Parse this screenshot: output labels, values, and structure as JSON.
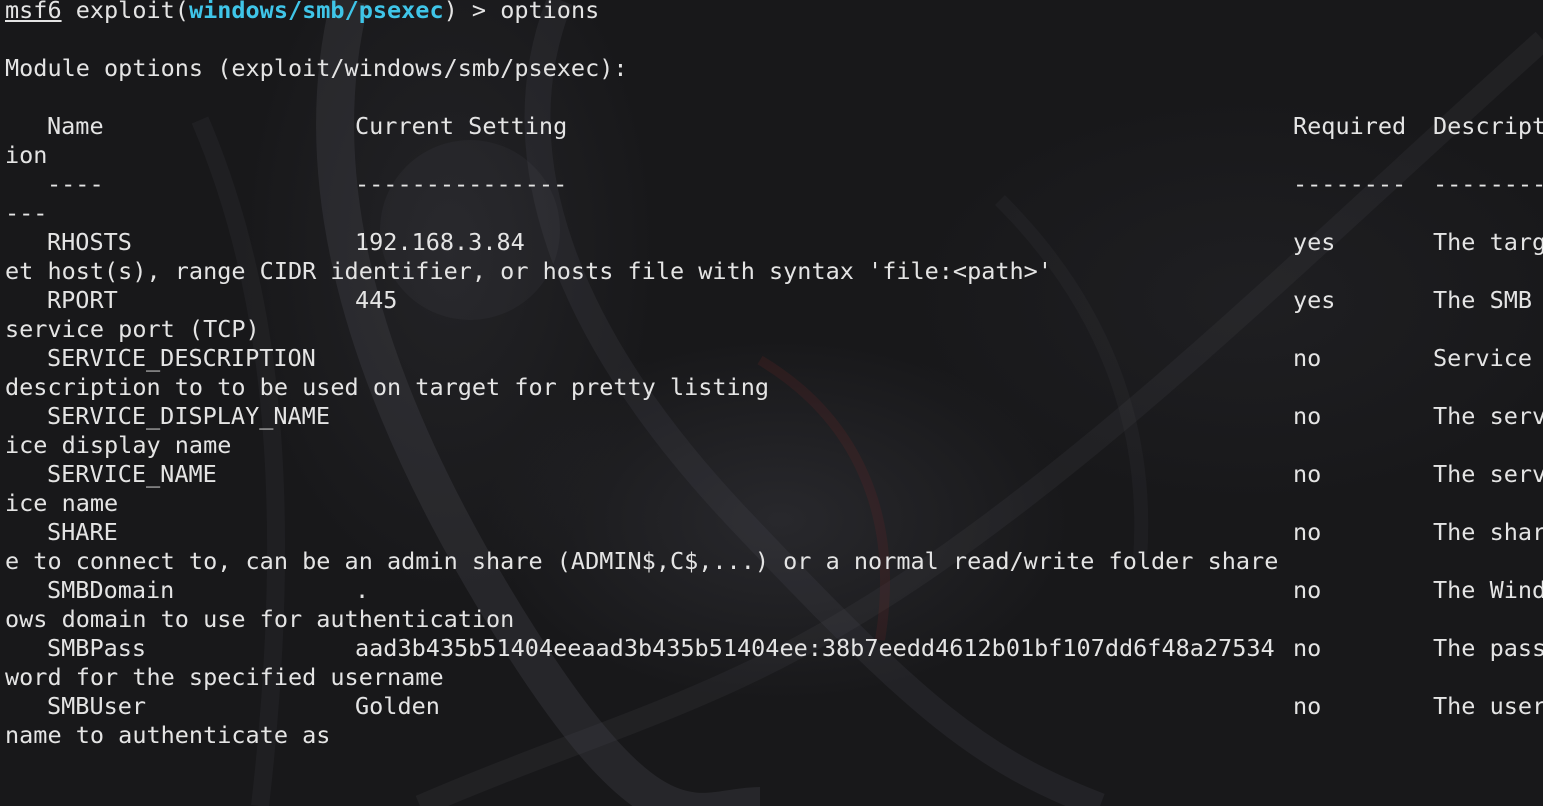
{
  "prompt": {
    "name": "msf6",
    "pre": " exploit(",
    "module": "windows/smb/psexec",
    "post": ") > ",
    "command": "options"
  },
  "section_title": "Module options (exploit/windows/smb/psexec):",
  "table": {
    "headers": [
      "Name",
      "Current Setting",
      "Required",
      "Descript"
    ],
    "header_wrap": "ion",
    "separators": [
      "----",
      "---------------",
      "--------",
      "--------"
    ],
    "separator_wrap": "---",
    "rows": [
      {
        "name": "RHOSTS",
        "setting": "192.168.3.84",
        "required": "yes",
        "desc": "The targ",
        "wrap": "et host(s), range CIDR identifier, or hosts file with syntax 'file:<path>'"
      },
      {
        "name": "RPORT",
        "setting": "445",
        "required": "yes",
        "desc": "The SMB",
        "wrap": "service port (TCP)"
      },
      {
        "name": "SERVICE_DESCRIPTION",
        "setting": "",
        "required": "no",
        "desc": "Service",
        "wrap": "description to to be used on target for pretty listing"
      },
      {
        "name": "SERVICE_DISPLAY_NAME",
        "setting": "",
        "required": "no",
        "desc": "The serv",
        "wrap": "ice display name"
      },
      {
        "name": "SERVICE_NAME",
        "setting": "",
        "required": "no",
        "desc": "The serv",
        "wrap": "ice name"
      },
      {
        "name": "SHARE",
        "setting": "",
        "required": "no",
        "desc": "The shar",
        "wrap": "e to connect to, can be an admin share (ADMIN$,C$,...) or a normal read/write folder share"
      },
      {
        "name": "SMBDomain",
        "setting": ".",
        "required": "no",
        "desc": "The Wind",
        "wrap": "ows domain to use for authentication"
      },
      {
        "name": "SMBPass",
        "setting": "aad3b435b51404eeaad3b435b51404ee:38b7eedd4612b01bf107dd6f48a27534",
        "required": "no",
        "desc": "The pass",
        "wrap": "word for the specified username"
      },
      {
        "name": "SMBUser",
        "setting": "Golden",
        "required": "no",
        "desc": "The user",
        "wrap": "name to authenticate as"
      }
    ]
  },
  "colors": {
    "background": "#18181a",
    "text": "#e4e4e4",
    "module_highlight": "#3fc5e8"
  }
}
